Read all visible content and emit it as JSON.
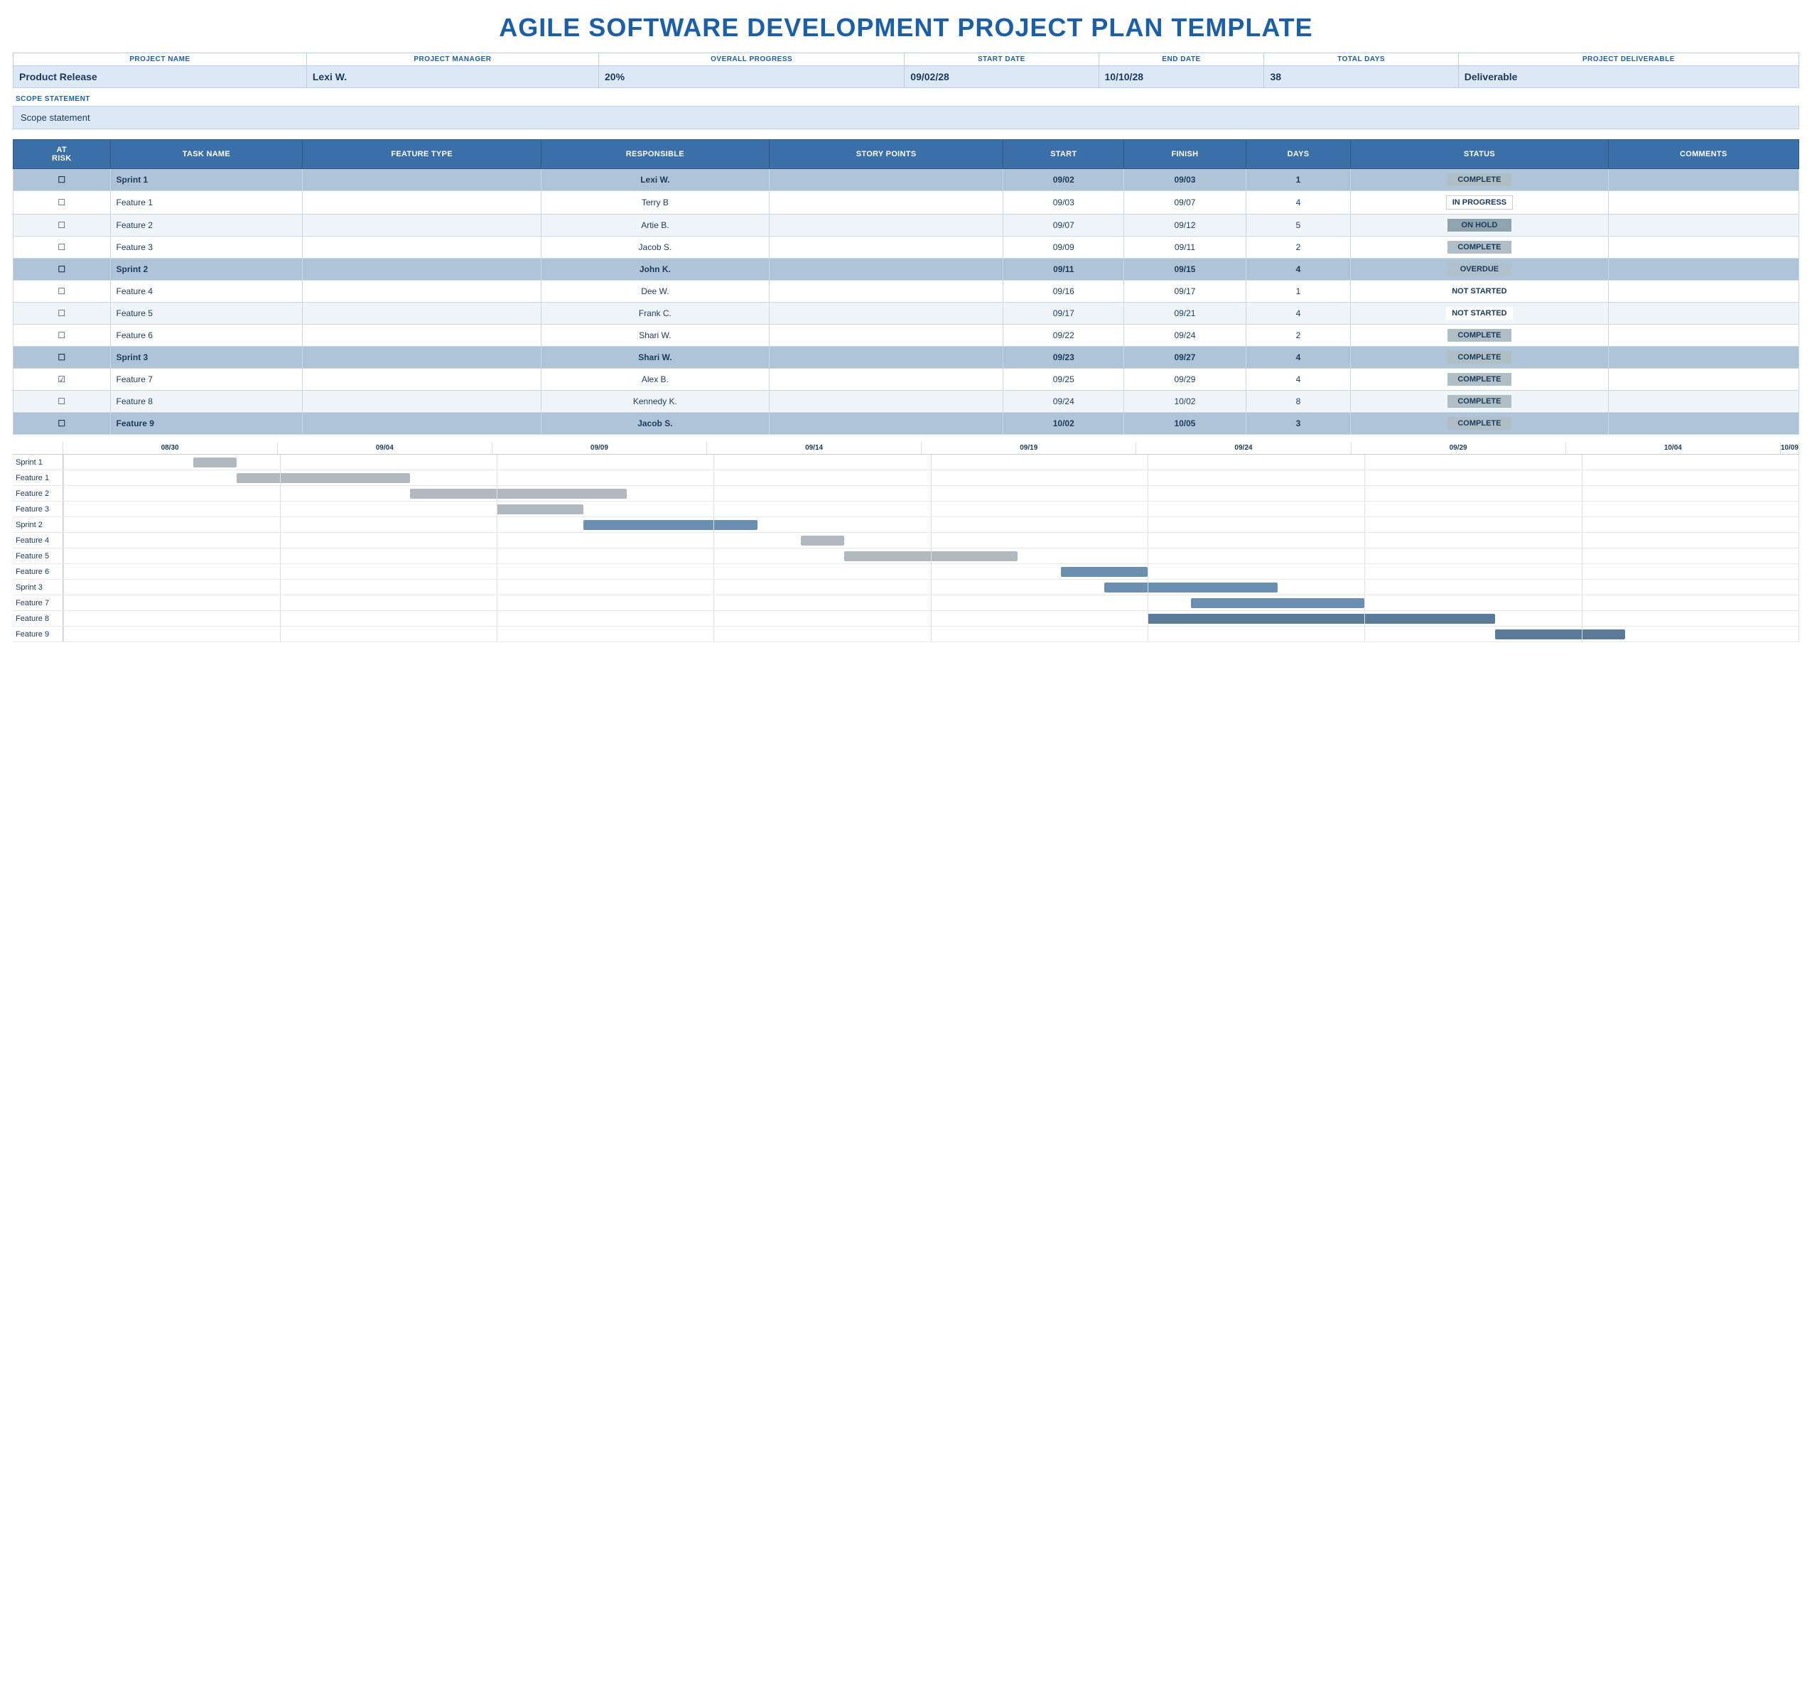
{
  "title": "AGILE SOFTWARE DEVELOPMENT PROJECT PLAN TEMPLATE",
  "project": {
    "name_label": "PROJECT NAME",
    "manager_label": "PROJECT MANAGER",
    "progress_label": "OVERALL PROGRESS",
    "start_label": "START DATE",
    "end_label": "END DATE",
    "days_label": "TOTAL DAYS",
    "deliverable_label": "PROJECT DELIVERABLE",
    "name": "Product Release",
    "manager": "Lexi W.",
    "progress": "20%",
    "start": "09/02/28",
    "end": "10/10/28",
    "days": "38",
    "deliverable": "Deliverable"
  },
  "scope": {
    "label": "SCOPE STATEMENT",
    "value": "Scope statement"
  },
  "table": {
    "headers": [
      "AT RISK",
      "TASK NAME",
      "FEATURE TYPE",
      "RESPONSIBLE",
      "STORY POINTS",
      "START",
      "FINISH",
      "DAYS",
      "STATUS",
      "COMMENTS"
    ],
    "rows": [
      {
        "at_risk": "☐",
        "task": "Sprint 1",
        "feature_type": "",
        "responsible": "Lexi W.",
        "story_points": "",
        "start": "09/02",
        "finish": "09/03",
        "days": "1",
        "status": "COMPLETE",
        "status_class": "status-complete",
        "comments": "",
        "row_class": "sprint-row"
      },
      {
        "at_risk": "☐",
        "task": "Feature 1",
        "feature_type": "",
        "responsible": "Terry B",
        "story_points": "",
        "start": "09/03",
        "finish": "09/07",
        "days": "4",
        "status": "IN PROGRESS",
        "status_class": "status-inprogress",
        "comments": "",
        "row_class": "feature-row-light"
      },
      {
        "at_risk": "☐",
        "task": "Feature 2",
        "feature_type": "",
        "responsible": "Artie B.",
        "story_points": "",
        "start": "09/07",
        "finish": "09/12",
        "days": "5",
        "status": "ON HOLD",
        "status_class": "status-onhold",
        "comments": "",
        "row_class": "feature-row-alt"
      },
      {
        "at_risk": "☐",
        "task": "Feature 3",
        "feature_type": "",
        "responsible": "Jacob S.",
        "story_points": "",
        "start": "09/09",
        "finish": "09/11",
        "days": "2",
        "status": "COMPLETE",
        "status_class": "status-complete",
        "comments": "",
        "row_class": "feature-row-light"
      },
      {
        "at_risk": "☐",
        "task": "Sprint 2",
        "feature_type": "",
        "responsible": "John K.",
        "story_points": "",
        "start": "09/11",
        "finish": "09/15",
        "days": "4",
        "status": "OVERDUE",
        "status_class": "status-overdue",
        "comments": "",
        "row_class": "sprint-row"
      },
      {
        "at_risk": "☐",
        "task": "Feature 4",
        "feature_type": "",
        "responsible": "Dee W.",
        "story_points": "",
        "start": "09/16",
        "finish": "09/17",
        "days": "1",
        "status": "NOT STARTED",
        "status_class": "status-notstarted",
        "comments": "",
        "row_class": "feature-row-light"
      },
      {
        "at_risk": "☐",
        "task": "Feature 5",
        "feature_type": "",
        "responsible": "Frank C.",
        "story_points": "",
        "start": "09/17",
        "finish": "09/21",
        "days": "4",
        "status": "NOT STARTED",
        "status_class": "status-notstarted",
        "comments": "",
        "row_class": "feature-row-alt"
      },
      {
        "at_risk": "☐",
        "task": "Feature 6",
        "feature_type": "",
        "responsible": "Shari W.",
        "story_points": "",
        "start": "09/22",
        "finish": "09/24",
        "days": "2",
        "status": "COMPLETE",
        "status_class": "status-complete",
        "comments": "",
        "row_class": "feature-row-light"
      },
      {
        "at_risk": "☐",
        "task": "Sprint 3",
        "feature_type": "",
        "responsible": "Shari W.",
        "story_points": "",
        "start": "09/23",
        "finish": "09/27",
        "days": "4",
        "status": "COMPLETE",
        "status_class": "status-complete",
        "comments": "",
        "row_class": "sprint-row"
      },
      {
        "at_risk": "☑",
        "task": "Feature 7",
        "feature_type": "",
        "responsible": "Alex B.",
        "story_points": "",
        "start": "09/25",
        "finish": "09/29",
        "days": "4",
        "status": "COMPLETE",
        "status_class": "status-complete",
        "comments": "",
        "row_class": "feature-row-light"
      },
      {
        "at_risk": "☐",
        "task": "Feature 8",
        "feature_type": "",
        "responsible": "Kennedy K.",
        "story_points": "",
        "start": "09/24",
        "finish": "10/02",
        "days": "8",
        "status": "COMPLETE",
        "status_class": "status-complete",
        "comments": "",
        "row_class": "feature-row-alt"
      },
      {
        "at_risk": "☐",
        "task": "Feature 9",
        "feature_type": "",
        "responsible": "Jacob S.",
        "story_points": "",
        "start": "10/02",
        "finish": "10/05",
        "days": "3",
        "status": "COMPLETE",
        "status_class": "status-complete",
        "comments": "",
        "row_class": "sprint-row"
      }
    ]
  },
  "gantt": {
    "axis_labels": [
      "08/30",
      "09/04",
      "09/09",
      "09/14",
      "09/19",
      "09/24",
      "09/29",
      "10/04",
      "10/09"
    ],
    "rows": [
      {
        "label": "Sprint 1",
        "bar_start_pct": 2,
        "bar_width_pct": 5,
        "bar_type": "gray"
      },
      {
        "label": "Feature 1",
        "bar_start_pct": 5,
        "bar_width_pct": 10,
        "bar_type": "gray"
      },
      {
        "label": "Feature 2",
        "bar_start_pct": 9,
        "bar_width_pct": 13,
        "bar_type": "gray"
      },
      {
        "label": "Feature 3",
        "bar_start_pct": 11,
        "bar_width_pct": 5,
        "bar_type": "gray"
      },
      {
        "label": "Sprint 2",
        "bar_start_pct": 14,
        "bar_width_pct": 11,
        "bar_type": "blue"
      },
      {
        "label": "Feature 4",
        "bar_start_pct": 19,
        "bar_width_pct": 4,
        "bar_type": "gray"
      },
      {
        "label": "Feature 5",
        "bar_start_pct": 21,
        "bar_width_pct": 10,
        "bar_type": "gray"
      },
      {
        "label": "Feature 6",
        "bar_start_pct": 28,
        "bar_width_pct": 6,
        "bar_type": "blue"
      },
      {
        "label": "Sprint 3",
        "bar_start_pct": 30,
        "bar_width_pct": 10,
        "bar_type": "blue"
      },
      {
        "label": "Feature 7",
        "bar_start_pct": 32,
        "bar_width_pct": 11,
        "bar_type": "blue"
      },
      {
        "label": "Feature 8",
        "bar_start_pct": 31,
        "bar_width_pct": 19,
        "bar_type": "dark"
      },
      {
        "label": "Feature 9",
        "bar_start_pct": 44,
        "bar_width_pct": 10,
        "bar_type": "dark"
      }
    ]
  }
}
